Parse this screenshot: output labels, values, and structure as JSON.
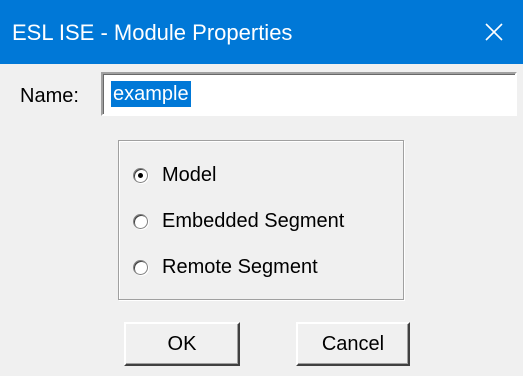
{
  "window": {
    "title": "ESL ISE - Module Properties",
    "close_icon": "close-icon",
    "titlebar_color": "#0078d7"
  },
  "form": {
    "name_label": "Name:",
    "name_value": "example"
  },
  "module_type": {
    "options": [
      {
        "label": "Model",
        "selected": true
      },
      {
        "label": "Embedded Segment",
        "selected": false
      },
      {
        "label": "Remote Segment",
        "selected": false
      }
    ]
  },
  "buttons": {
    "ok_label": "OK",
    "cancel_label": "Cancel"
  }
}
